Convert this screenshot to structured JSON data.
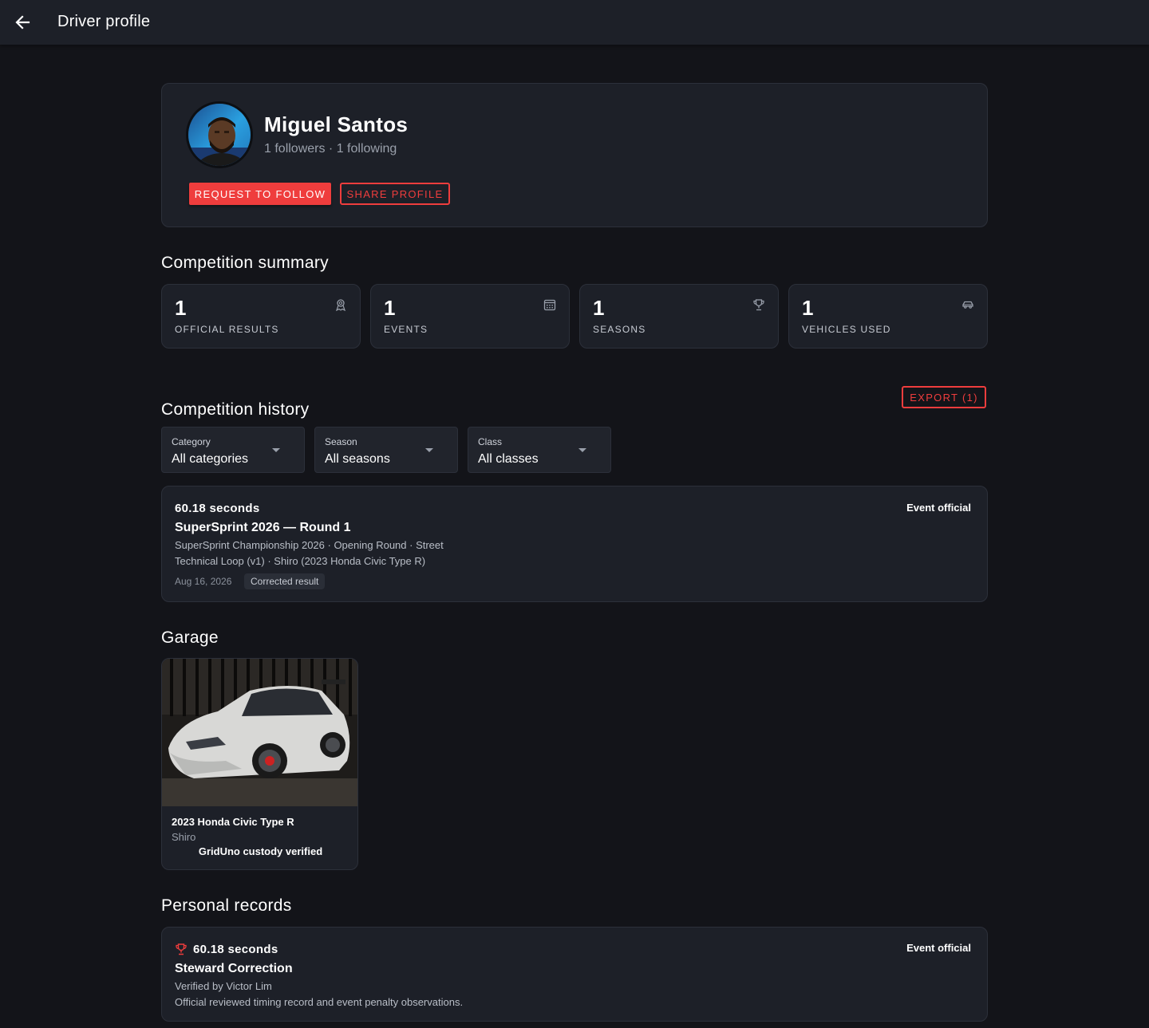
{
  "appbar": {
    "title": "Driver profile"
  },
  "profile": {
    "name": "Miguel Santos",
    "followers_text": "1 followers · 1 following",
    "request_button": "REQUEST TO FOLLOW",
    "share_button": "SHARE PROFILE"
  },
  "summary": {
    "title": "Competition summary",
    "stats": [
      {
        "value": "1",
        "label": "OFFICIAL RESULTS",
        "icon": "award-icon"
      },
      {
        "value": "1",
        "label": "EVENTS",
        "icon": "calendar-icon"
      },
      {
        "value": "1",
        "label": "SEASONS",
        "icon": "trophy-icon"
      },
      {
        "value": "1",
        "label": "VEHICLES USED",
        "icon": "car-icon"
      }
    ]
  },
  "history": {
    "title": "Competition history",
    "export_button": "EXPORT (1)",
    "filters": [
      {
        "label": "Category",
        "value": "All categories"
      },
      {
        "label": "Season",
        "value": "All seasons"
      },
      {
        "label": "Class",
        "value": "All classes"
      }
    ],
    "results": [
      {
        "time": "60.18 seconds",
        "title": "SuperSprint 2026 — Round 1",
        "line1": "SuperSprint Championship 2026 · Opening Round · Street",
        "line2": "Technical Loop (v1) · Shiro (2023 Honda Civic Type R)",
        "date": "Aug 16, 2026",
        "chip": "Corrected result",
        "badge": "Event official"
      }
    ]
  },
  "garage": {
    "title": "Garage",
    "vehicles": [
      {
        "name": "2023 Honda Civic Type R",
        "nickname": "Shiro",
        "verified": "GridUno custody verified"
      }
    ]
  },
  "records": {
    "title": "Personal records",
    "items": [
      {
        "time": "60.18 seconds",
        "title": "Steward Correction",
        "verified_by": "Verified by Victor Lim",
        "description": "Official reviewed timing record and event penalty observations.",
        "badge": "Event official"
      }
    ]
  },
  "colors": {
    "accent": "#ef3d3d",
    "background": "#131419",
    "card": "#1d2028"
  }
}
